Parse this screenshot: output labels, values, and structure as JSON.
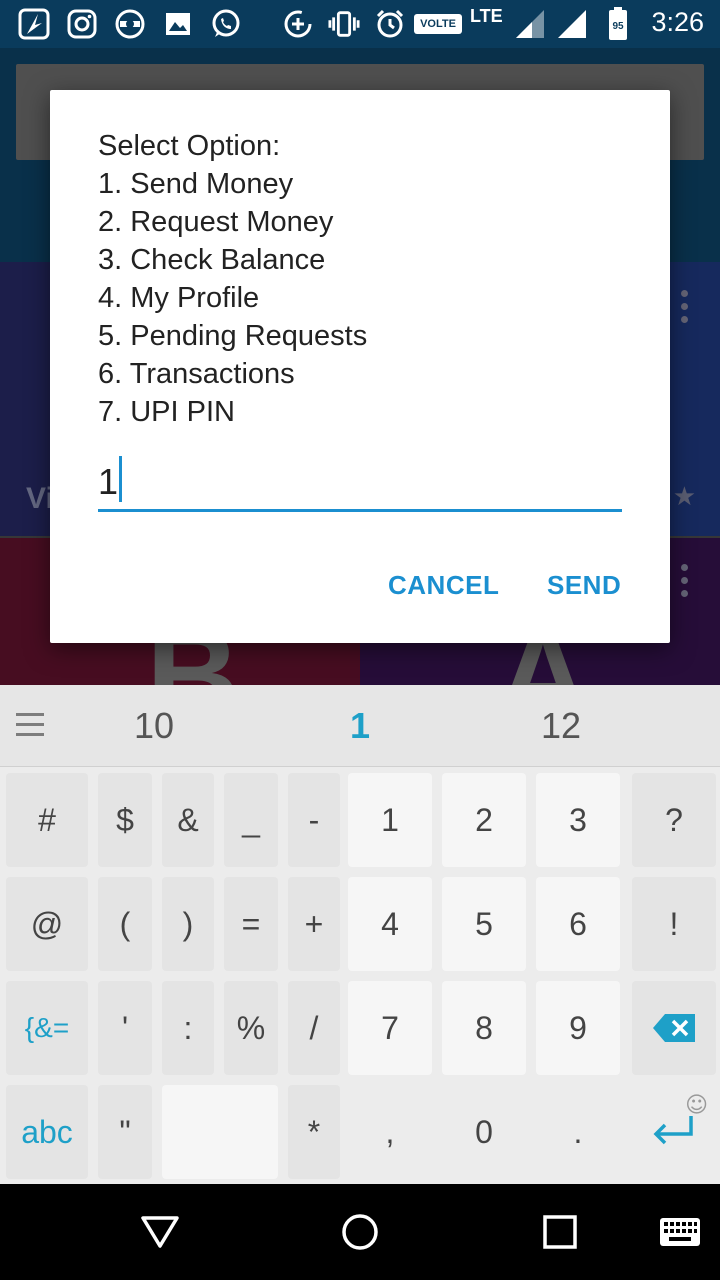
{
  "status_bar": {
    "time": "3:26",
    "network": "LTE",
    "volte": "VOLTE",
    "battery": "95",
    "icons": [
      "app-icon",
      "instagram-icon",
      "network-icon",
      "gallery-icon",
      "whatsapp-icon",
      "data-saver-icon",
      "vibrate-icon",
      "alarm-icon",
      "volte-icon",
      "signal-icon",
      "wifi-signal-icon",
      "battery-icon"
    ]
  },
  "background_app": {
    "tile_letters": [
      "B",
      "A"
    ],
    "tile_label": "Vi"
  },
  "dialog": {
    "lines": [
      "Select Option:",
      "1. Send Money",
      "2. Request Money",
      "3. Check Balance",
      "4. My Profile",
      "5. Pending Requests",
      "6. Transactions",
      "7. UPI PIN"
    ],
    "input_value": "1",
    "cancel_label": "CANCEL",
    "send_label": "SEND"
  },
  "keyboard": {
    "suggestions": [
      "10",
      "1",
      "12"
    ],
    "rows": [
      [
        "#",
        "$",
        "&",
        "_",
        "-",
        "1",
        "2",
        "3",
        "?"
      ],
      [
        "@",
        "(",
        ")",
        "=",
        "+",
        "4",
        "5",
        "6",
        "!"
      ],
      [
        "{&=",
        "'",
        ":",
        "%",
        "/",
        "7",
        "8",
        "9",
        "⌫"
      ],
      [
        "abc",
        "\"",
        "",
        "*",
        ",",
        "0",
        ".",
        "↵"
      ]
    ]
  },
  "colors": {
    "accent": "#1b8fd0",
    "status_bar": "#0a3b5c"
  }
}
